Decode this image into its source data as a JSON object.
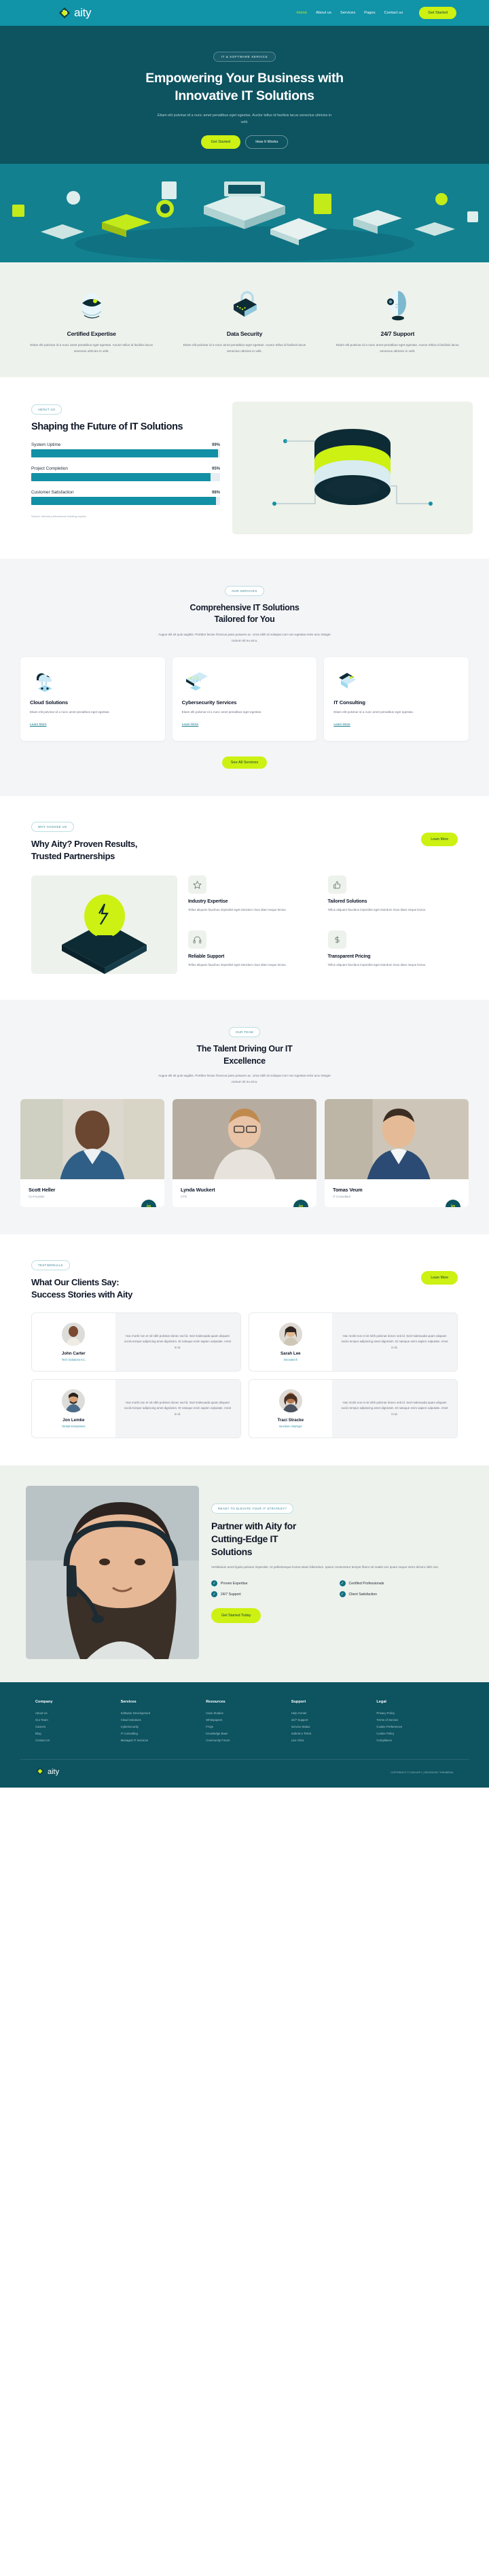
{
  "brand": {
    "name": "aity",
    "logo_icon": "diamond-logo-icon"
  },
  "header": {
    "nav": [
      {
        "label": "Home",
        "active": true
      },
      {
        "label": "About us",
        "active": false
      },
      {
        "label": "Services",
        "active": false
      },
      {
        "label": "Pages",
        "active": false
      },
      {
        "label": "Contact us",
        "active": false
      }
    ],
    "cta_label": "Get Started"
  },
  "hero": {
    "badge": "IT & SOFTWARE SERVICE",
    "title_line1": "Empowering Your Business with",
    "title_line2": "Innovative IT Solutions",
    "subtitle": "Etiam elit pulvinar id a nunc amet penatibus eget egestas. Auctor tellus id facilisis lacus senectus ultricies in velit.",
    "primary_btn": "Get Started",
    "secondary_btn": "How It Works"
  },
  "features": [
    {
      "icon": "robot-head-icon",
      "title": "Certified Expertise",
      "text": "Etiam elit pulvinar id a nunc amet penatibus eget egestas. Auctor tellus id facilisis lacus senectus ultricies in velit."
    },
    {
      "icon": "padlock-icon",
      "title": "Data Security",
      "text": "Etiam elit pulvinar id a nunc amet penatibus eget egestas. Auctor tellus id facilisis lacus senectus ultricies in velit."
    },
    {
      "icon": "headset-robot-icon",
      "title": "24/7 Support",
      "text": "Etiam elit pulvinar id a nunc amet penatibus eget egestas. Auctor tellus id facilisis lacus senectus ultricies in velit."
    }
  ],
  "about": {
    "badge": "ABOUT US",
    "title": "Shaping the Future of IT Solutions",
    "source_note": "Source: Internal performance tracking reports.",
    "illustration": "database-server-icon"
  },
  "chart_data": {
    "type": "bar",
    "title": "Shaping the Future of IT Solutions",
    "categories": [
      "System Uptime",
      "Project Completion",
      "Customer Satisfaction"
    ],
    "values": [
      99,
      95,
      98
    ],
    "value_labels": [
      "99%",
      "95%",
      "98%"
    ],
    "xlabel": "",
    "ylabel": "",
    "ylim": [
      0,
      100
    ],
    "orientation": "horizontal",
    "grid": false,
    "legend": false,
    "bar_color": "#1290a5",
    "track_color": "#e7edf0",
    "note": "Source: Internal performance tracking reports."
  },
  "services": {
    "badge": "OUR SERVICES",
    "title_line1": "Comprehensive IT Solutions",
    "title_line2": "Tailored for You",
    "subtitle": "Augue elit sit quis sagittis. Porttitor lectus rhoncus justo posuere ac. Urna nibh id volutpat cum non egestas enim arcu integer cursum sit eu arcu.",
    "link_label": "Learn More",
    "all_btn": "See All Services",
    "items": [
      {
        "icon": "cloud-icon",
        "title": "Cloud Solutions",
        "text": "Etiam elit pulvinar id a nunc amet penatibus eget egestas."
      },
      {
        "icon": "monitor-binary-icon",
        "title": "Cybersecurity Services",
        "text": "Etiam elit pulvinar id a nunc amet penatibus eget egestas."
      },
      {
        "icon": "documents-icon",
        "title": "IT Consulting",
        "text": "Etiam elit pulvinar id a nunc amet penatibus eget egestas."
      }
    ]
  },
  "why": {
    "badge": "WHY CHOOSE US",
    "title_line1": "Why Aity? Proven Results,",
    "title_line2": "Trusted Partnerships",
    "btn_label": "Learn More",
    "illustration": "lightbulb-idea-icon",
    "items": [
      {
        "icon": "star-icon",
        "glyph": "☆",
        "title": "Industry Expertise",
        "text": "Tellus aliquam faucibus imperdiet eget interdum risus diam neque lectus."
      },
      {
        "icon": "thumbs-up-icon",
        "glyph": "ὄD",
        "title": "Tailored Solutions",
        "text": "Tellus aliquam faucibus imperdiet eget interdum risus diam neque lectus."
      },
      {
        "icon": "headset-icon",
        "glyph": "Ω",
        "title": "Reliable Support",
        "text": "Tellus aliquam faucibus imperdiet eget interdum risus diam neque lectus."
      },
      {
        "icon": "dollar-icon",
        "glyph": "$",
        "title": "Transparent Pricing",
        "text": "Tellus aliquam faucibus imperdiet eget interdum risus diam neque lectus."
      }
    ]
  },
  "team": {
    "badge": "OUR TEAM",
    "title_line1": "The Talent Driving Our IT",
    "title_line2": "Excellence",
    "subtitle": "Augue elit sit quis sagittis. Porttitor lectus rhoncus justo posuere ac. Urna nibh id volutpat cum non egestas enim arcu integer cursum sit eu arcu.",
    "social_icon": "linkedin-icon",
    "social_label": "in",
    "members": [
      {
        "name": "Scott Heller",
        "role": "Co-Founder"
      },
      {
        "name": "Lynda Wuckert",
        "role": "CTO"
      },
      {
        "name": "Tomas Veum",
        "role": "IT Consultant"
      }
    ]
  },
  "testimonials": {
    "badge": "TESTIMONIALS",
    "title_line1": "What Our Clients Say:",
    "title_line2": "Success Stories with Aity",
    "btn_label": "Learn More",
    "items": [
      {
        "name": "John Carter",
        "company": "Tech Solutions Inc.",
        "quote": "Hac morbi non et sit nibh pulvinar donec sed id. Sed malesuada quam aliquam sociis tempor adipiscing amet dignissim. Et natoque enim sapien vulputate. Amet in id."
      },
      {
        "name": "Sarah Lee",
        "company": "Innovatech",
        "quote": "Hac morbi non et sit nibh pulvinar donec sed id. Sed malesuada quam aliquam sociis tempor adipiscing amet dignissim. Et natoque enim sapien vulputate. Amet in id."
      },
      {
        "name": "Jon Lemke",
        "company": "Global Enterprises",
        "quote": "Hac morbi non et sit nibh pulvinar donec sed id. Sed malesuada quam aliquam sociis tempor adipiscing amet dignissim. Et natoque enim sapien vulputate. Amet in id."
      },
      {
        "name": "Traci Stracke",
        "company": "NextGen Startups",
        "quote": "Hac morbi non et sit nibh pulvinar donec sed id. Sed malesuada quam aliquam sociis tempor adipiscing amet dignissim. Et natoque enim sapien vulputate. Amet in id."
      }
    ]
  },
  "cta": {
    "badge": "READY TO ELEVATE YOUR IT STRATEGY?",
    "title_line1": "Partner with Aity for",
    "title_line2": "Cutting-Edge IT",
    "title_line3": "Solutions",
    "text": "Vestibulum amet ligula pulvinar imperdiet. Ut pellentesque lectus etiam bibendum. Ipsum consectetur tempor libero sit mattis orci quam neque tortor dictum nibh non.",
    "ticks": [
      "Proven Expertise",
      "Certified Professionals",
      "24/7 Support",
      "Client Satisfaction"
    ],
    "btn_label": "Get Started Today",
    "image": "support-agent-headset-photo"
  },
  "footer": {
    "columns": [
      {
        "title": "Company",
        "links": [
          "About Us",
          "Our Team",
          "Careers",
          "Blog",
          "Contact Us"
        ]
      },
      {
        "title": "Services",
        "links": [
          "Software Development",
          "Cloud Solutions",
          "Cybersecurity",
          "IT Consulting",
          "Managed IT Services"
        ]
      },
      {
        "title": "Resources",
        "links": [
          "Case Studies",
          "Whitepapers",
          "FAQs",
          "Knowledge Base",
          "Community Forum"
        ]
      },
      {
        "title": "Support",
        "links": [
          "Help Center",
          "24/7 Support",
          "Service Status",
          "Submit a Ticket",
          "Live Chat"
        ]
      },
      {
        "title": "Legal",
        "links": [
          "Privacy Policy",
          "Terms of Service",
          "Cookie Preferences",
          "Cookie Policy",
          "Compliance"
        ]
      }
    ],
    "copyright": "COPYRIGHT © 2024 AITY | DESIGN BY THEMERAL"
  },
  "colors": {
    "teal_header": "#1193a8",
    "teal_dark": "#0d5360",
    "lime": "#ccf113",
    "bar": "#1290a5",
    "cream": "#eef2ec"
  }
}
